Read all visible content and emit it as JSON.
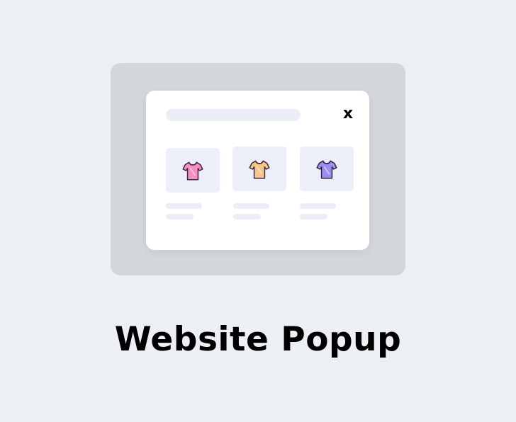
{
  "popup": {
    "close_label": "x",
    "products": [
      {
        "icon": "tshirt-icon",
        "color": "#f78fc3",
        "shade": "#ea6fae"
      },
      {
        "icon": "tshirt-icon",
        "color": "#f7c48a",
        "shade": "#e6a866"
      },
      {
        "icon": "tshirt-icon",
        "color": "#9f8cf2",
        "shade": "#7f6be0"
      }
    ]
  },
  "caption": "Website Popup",
  "colors": {
    "background": "#eceff4",
    "backdrop": "#d3d6db",
    "popup": "#ffffff",
    "placeholder": "#eceef7"
  }
}
